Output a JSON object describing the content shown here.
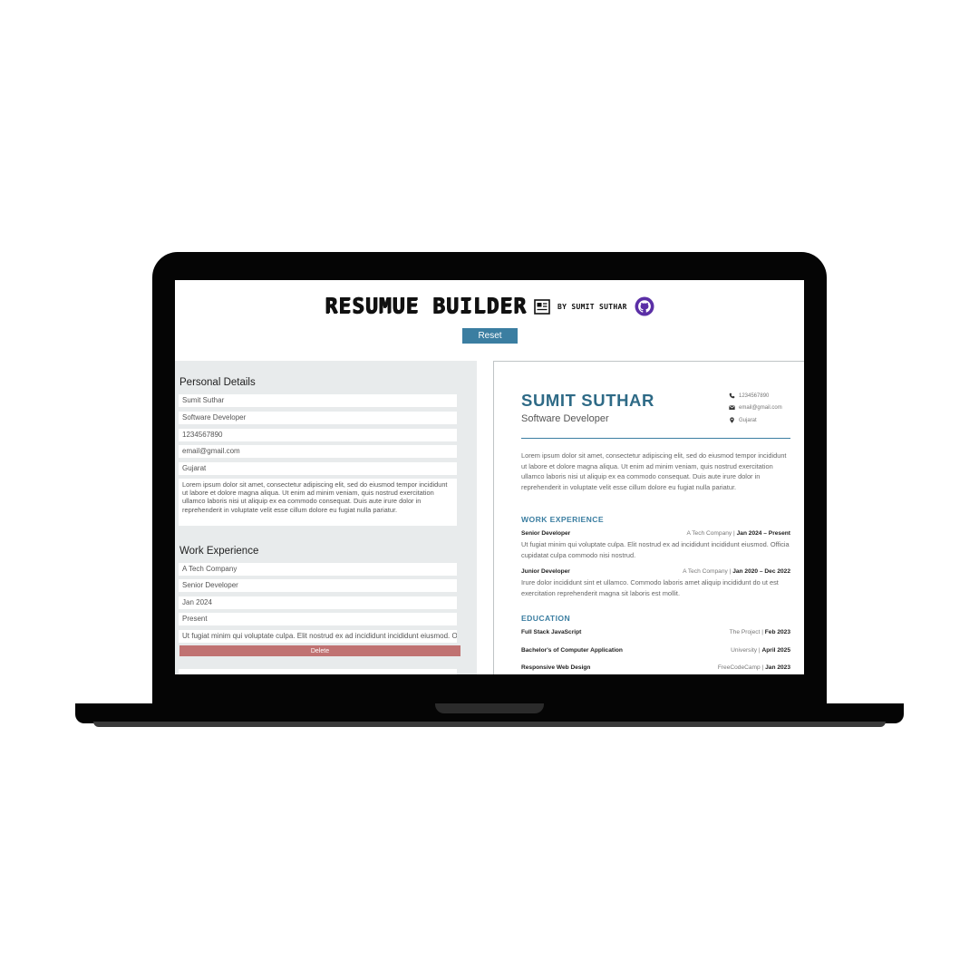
{
  "header": {
    "brand": "RESUMUE BUILDER",
    "byline": "BY SUMIT SUTHAR",
    "reset_label": "Reset"
  },
  "editor": {
    "personal_title": "Personal Details",
    "personal_fields": {
      "name": "Sumit Suthar",
      "title": "Software Developer",
      "phone": "1234567890",
      "email": "email@gmail.com",
      "location": "Gujarat",
      "summary": "Lorem ipsum dolor sit amet, consectetur adipiscing elit, sed do eiusmod tempor incididunt ut labore et dolore magna aliqua. Ut enim ad minim veniam, quis nostrud exercitation ullamco laboris nisi ut aliquip ex ea commodo consequat. Duis aute irure dolor in reprehenderit in voluptate velit esse cillum dolore eu fugiat nulla pariatur."
    },
    "work_title": "Work Experience",
    "work_fields": {
      "company": "A Tech Company",
      "position": "Senior Developer",
      "start": "Jan 2024",
      "end": "Present",
      "description": "Ut fugiat minim qui voluptate culpa. Elit nostrud ex ad incididunt incididunt eiusmod. Officia cupidatat culpa commodo nisi nostrud."
    },
    "delete_label": "Delete"
  },
  "preview": {
    "name": "SUMIT SUTHAR",
    "role": "Software Developer",
    "phone": "1234567890",
    "email": "email@gmail.com",
    "location": "Gujarat",
    "summary": "Lorem ipsum dolor sit amet, consectetur adipiscing elit, sed do eiusmod tempor incididunt ut labore et dolore magna aliqua. Ut enim ad minim veniam, quis nostrud exercitation ullamco laboris nisi ut aliquip ex ea commodo consequat. Duis aute irure dolor in reprehenderit in voluptate velit esse cillum dolore eu fugiat nulla pariatur.",
    "work_heading": "WORK EXPERIENCE",
    "jobs": [
      {
        "position": "Senior Developer",
        "company": "A Tech Company |",
        "dates": "Jan 2024 – Present",
        "description": "Ut fugiat minim qui voluptate culpa. Elit nostrud ex ad incididunt incididunt eiusmod. Officia cupidatat culpa commodo nisi nostrud."
      },
      {
        "position": "Junior Developer",
        "company": "A Tech Company |",
        "dates": "Jan 2020 – Dec 2022",
        "description": "Irure dolor incididunt sint et ullamco. Commodo laboris amet aliquip incididunt do ut est exercitation reprehenderit magna sit laboris est mollit."
      }
    ],
    "education_heading": "EDUCATION",
    "education": [
      {
        "course": "Full Stack JavaScript",
        "school": "The Project |",
        "date": "Feb 2023"
      },
      {
        "course": "Bachelor's of Computer Application",
        "school": "University |",
        "date": "April 2025"
      },
      {
        "course": "Responsive Web Design",
        "school": "FreeCodeCamp |",
        "date": "Jan 2023"
      }
    ]
  },
  "icons": {
    "doc": "id-card-icon",
    "github": "github-icon",
    "phone": "phone-icon",
    "mail": "mail-icon",
    "pin": "location-pin-icon"
  },
  "colors": {
    "accent": "#3b7ea1",
    "name": "#2e6a86",
    "delete": "#c07272",
    "editor_bg": "#e8ebec",
    "github": "#5b2fa6"
  }
}
